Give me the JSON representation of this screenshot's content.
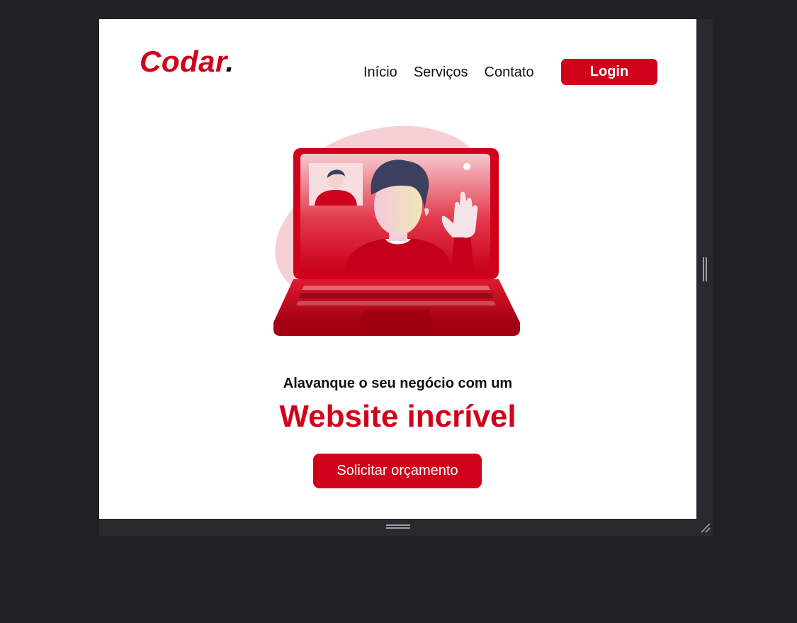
{
  "header": {
    "logo_text": "Codar",
    "logo_dot": ".",
    "nav": [
      {
        "label": "Início"
      },
      {
        "label": "Serviços"
      },
      {
        "label": "Contato"
      }
    ],
    "login_label": "Login"
  },
  "hero": {
    "tagline": "Alavanque o seu negócio com um",
    "headline": "Website incrível",
    "cta_label": "Solicitar orçamento"
  },
  "colors": {
    "accent": "#d0021b",
    "text": "#111111",
    "page_bg": "#ffffff",
    "window_bg": "#202124"
  },
  "icons": [
    "laptop-video-call-illustration",
    "resize-handle-icon",
    "resize-corner-icon"
  ]
}
